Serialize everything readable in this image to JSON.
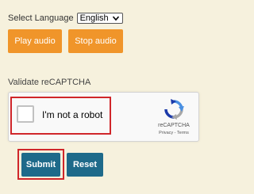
{
  "language": {
    "label": "Select Language",
    "selected": "English"
  },
  "audio": {
    "play_label": "Play audio",
    "stop_label": "Stop audio"
  },
  "recaptcha": {
    "section_label": "Validate reCAPTCHA",
    "checkbox_text": "I'm not a robot",
    "brand": "reCAPTCHA",
    "terms": "Privacy - Terms"
  },
  "form": {
    "submit_label": "Submit",
    "reset_label": "Reset"
  },
  "colors": {
    "page_bg": "#f6f1dd",
    "orange_button": "#f0952a",
    "teal_button": "#1e6a8a",
    "highlight": "#d0262a",
    "recaptcha_blue": "#4a90e2"
  },
  "icons": {
    "select_arrow": "chevron-down-icon",
    "recaptcha_logo": "recaptcha-logo-icon"
  }
}
